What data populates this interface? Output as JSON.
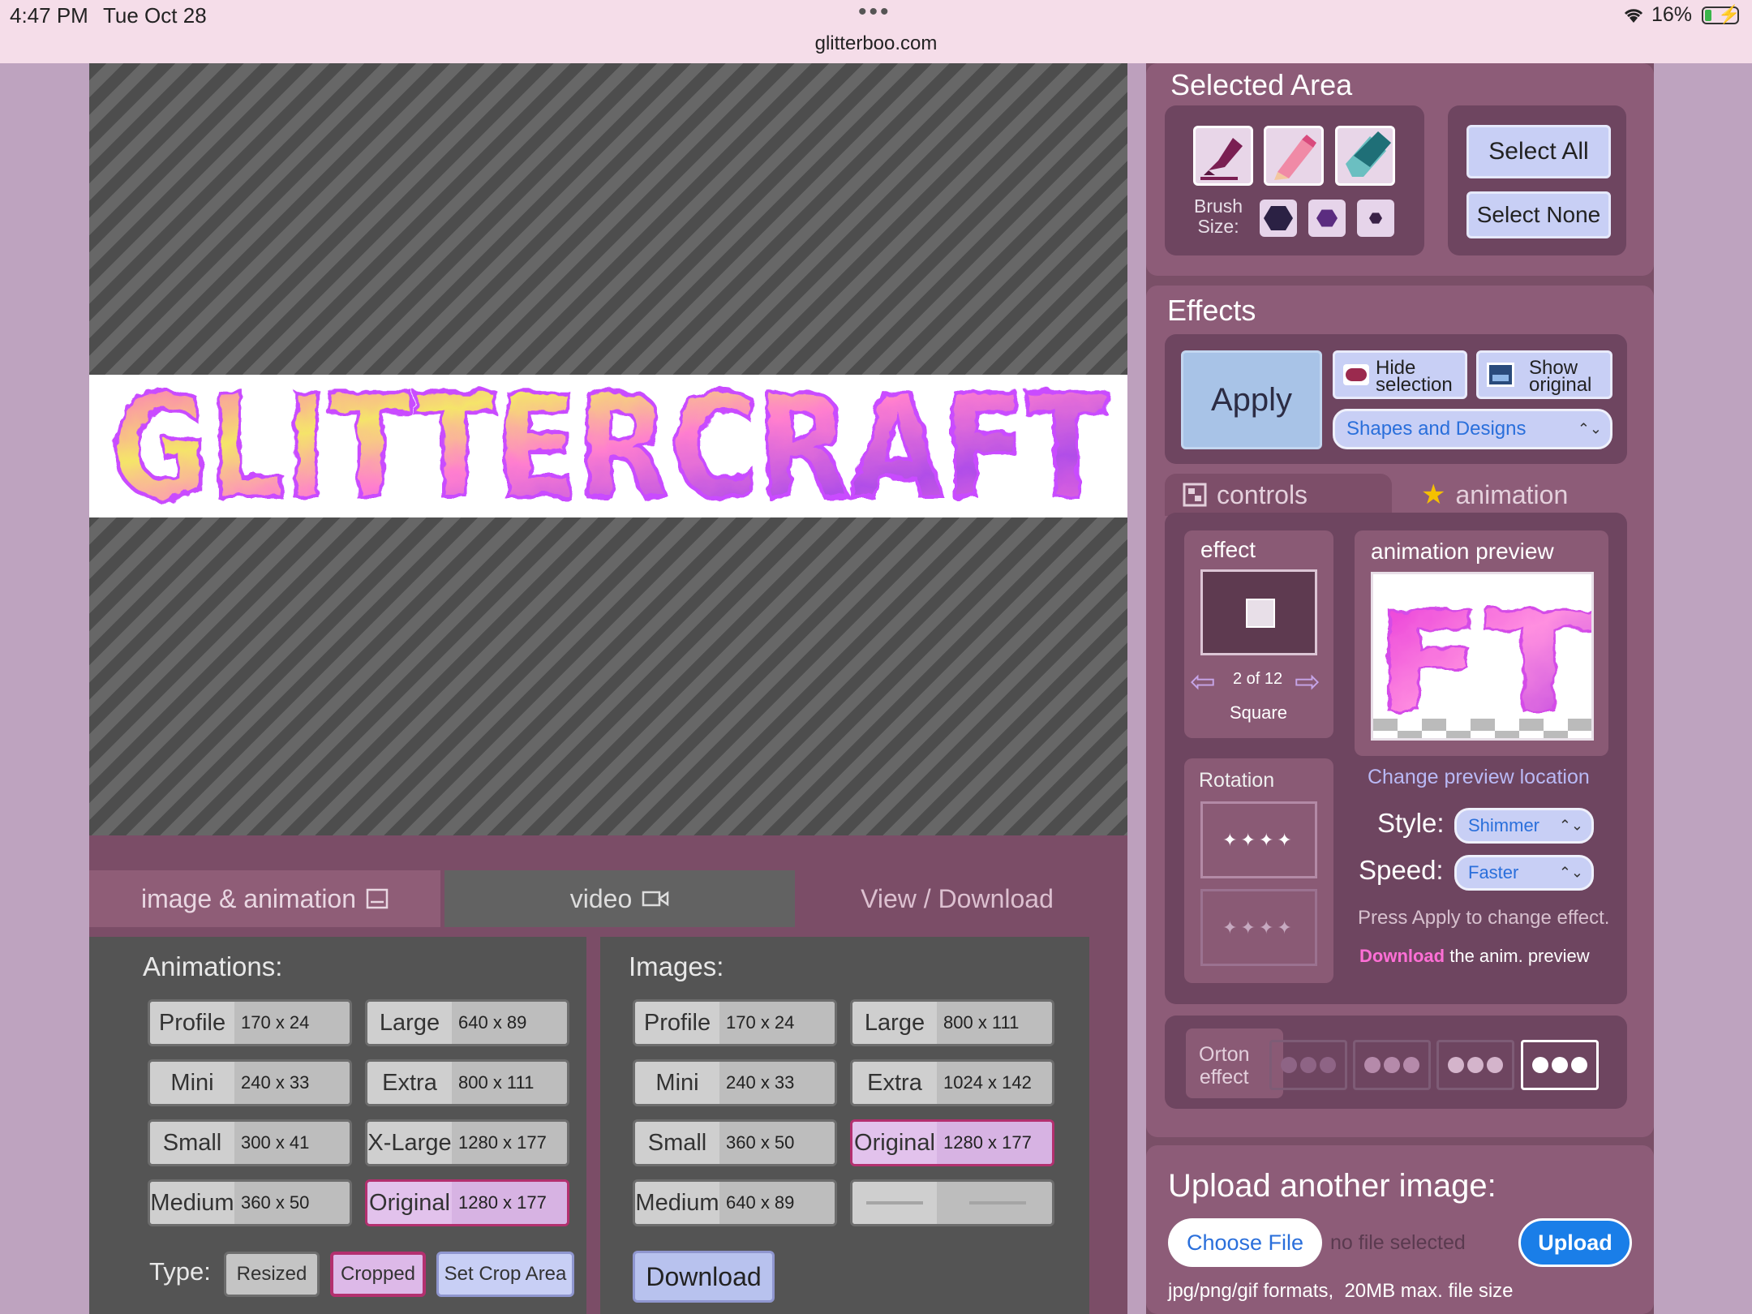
{
  "status": {
    "time": "4:47 PM",
    "date": "Tue Oct 28",
    "url": "glitterboo.com",
    "battery": "16%"
  },
  "canvas": {
    "text": "GLITTERCRAFT"
  },
  "tabs": {
    "image_animation": "image & animation",
    "video": "video",
    "view_download": "View / Download"
  },
  "animations": {
    "title": "Animations:",
    "items": [
      {
        "name": "Profile",
        "dims": "170 x 24"
      },
      {
        "name": "Large",
        "dims": "640 x 89"
      },
      {
        "name": "Mini",
        "dims": "240 x 33"
      },
      {
        "name": "Extra",
        "dims": "800 x 111"
      },
      {
        "name": "Small",
        "dims": "300 x 41"
      },
      {
        "name": "X-Large",
        "dims": "1280 x 177"
      },
      {
        "name": "Medium",
        "dims": "360 x 50"
      },
      {
        "name": "Original",
        "dims": "1280 x 177",
        "selected": true
      }
    ],
    "type_label": "Type:",
    "type_options": [
      "Resized",
      "Cropped",
      "Set Crop Area"
    ],
    "type_selected": "Cropped"
  },
  "images": {
    "title": "Images:",
    "items": [
      {
        "name": "Profile",
        "dims": "170 x 24"
      },
      {
        "name": "Large",
        "dims": "800 x 111"
      },
      {
        "name": "Mini",
        "dims": "240 x 33"
      },
      {
        "name": "Extra",
        "dims": "1024 x 142"
      },
      {
        "name": "Small",
        "dims": "360 x 50"
      },
      {
        "name": "Original",
        "dims": "1280 x 177",
        "selected": true
      },
      {
        "name": "Medium",
        "dims": "640 x 89"
      },
      {
        "name": "",
        "dims": "",
        "empty": true
      }
    ],
    "download": "Download"
  },
  "selected_area": {
    "title": "Selected Area",
    "brush_label_1": "Brush",
    "brush_label_2": "Size:",
    "select_all": "Select All",
    "select_none": "Select None"
  },
  "effects": {
    "title": "Effects",
    "apply": "Apply",
    "hide_1": "Hide",
    "hide_2": "selection",
    "show_1": "Show",
    "show_2": "original",
    "category": "Shapes and Designs",
    "tab_controls": "controls",
    "tab_animation": "animation",
    "effect_label": "effect",
    "counter": "2 of 12",
    "effect_name": "Square",
    "preview_label": "animation preview",
    "rotation_label": "Rotation",
    "change_preview": "Change preview location",
    "style_label": "Style:",
    "style_value": "Shimmer",
    "speed_label": "Speed:",
    "speed_value": "Faster",
    "press_apply": "Press Apply to change effect.",
    "download_link": "Download",
    "download_rest": " the anim. preview",
    "orton_1": "Orton",
    "orton_2": "effect"
  },
  "upload": {
    "title": "Upload another image:",
    "choose": "Choose File",
    "no_file": "no file selected",
    "upload_btn": "Upload",
    "note": "jpg/png/gif formats,  20MB max. file size"
  },
  "colors": {
    "accent_pink": "#ff6fd6",
    "link_blue": "#2a6fdb",
    "upload_blue": "#1a7ee8"
  }
}
